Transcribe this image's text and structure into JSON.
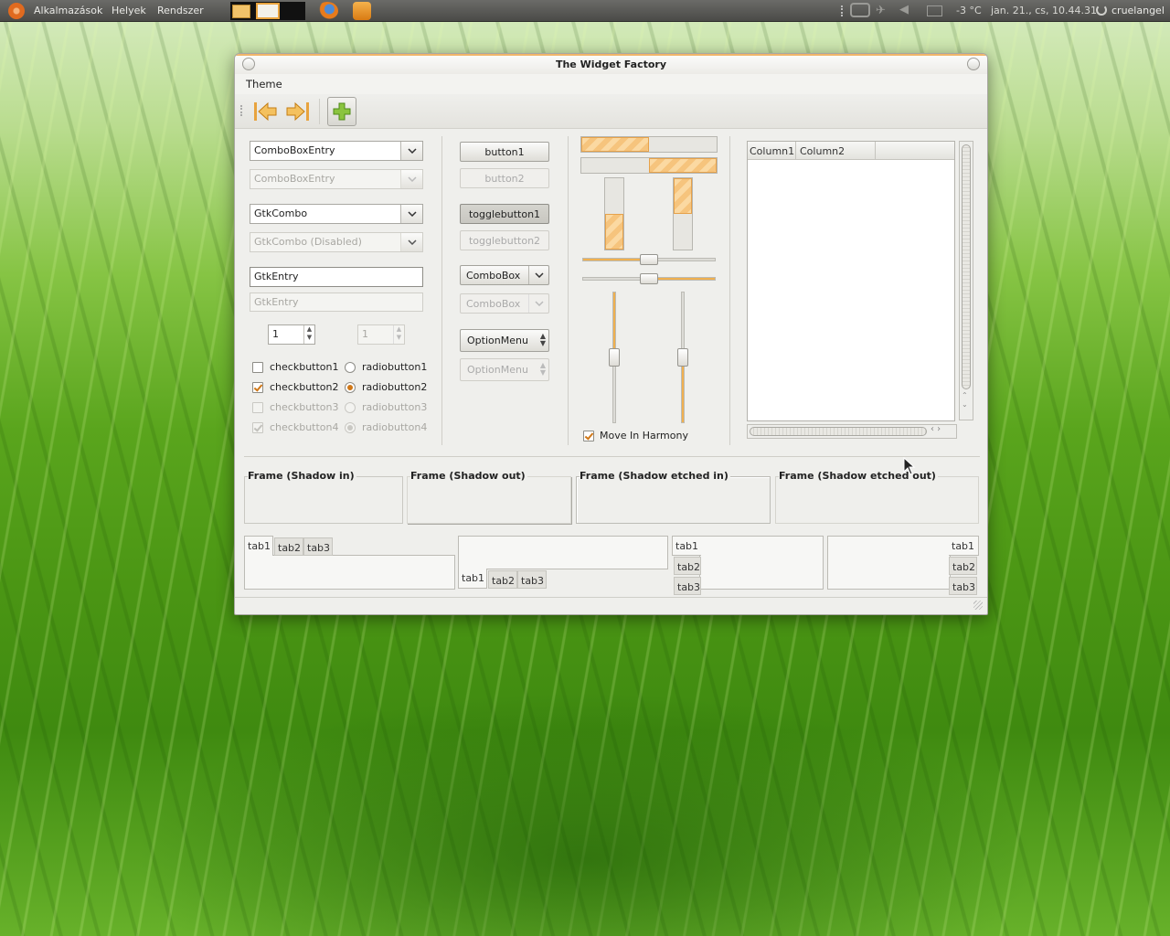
{
  "panel": {
    "menus": [
      "Alkalmazások",
      "Helyek",
      "Rendszer"
    ],
    "weather": "-3 °C",
    "clock": "jan. 21., cs, 10.44.31",
    "user": "cruelangel"
  },
  "window": {
    "title": "The Widget Factory",
    "menu_theme": "Theme"
  },
  "col1": {
    "combo_entry": "ComboBoxEntry",
    "combo_entry_dis": "ComboBoxEntry",
    "gtk_combo": "GtkCombo",
    "gtk_combo_dis": "GtkCombo (Disabled)",
    "entry": "GtkEntry",
    "entry_dis": "GtkEntry",
    "spin": "1",
    "spin_dis": "1",
    "checks": [
      "checkbutton1",
      "checkbutton2",
      "checkbutton3",
      "checkbutton4"
    ],
    "radios": [
      "radiobutton1",
      "radiobutton2",
      "radiobutton3",
      "radiobutton4"
    ]
  },
  "col2": {
    "button1": "button1",
    "button2": "button2",
    "toggle1": "togglebutton1",
    "toggle2": "togglebutton2",
    "combobox": "ComboBox",
    "combobox_dis": "ComboBox",
    "option": "OptionMenu",
    "option_dis": "OptionMenu"
  },
  "col3": {
    "harmony": "Move In Harmony",
    "progress_h1": 0.5,
    "progress_h2": 0.5,
    "progress_v1": 0.5,
    "progress_v2": 0.5,
    "scale_h1": 0.5,
    "scale_h2": 0.5,
    "scale_v1": 0.5,
    "scale_v2": 0.5
  },
  "tree": {
    "columns": [
      "Column1",
      "Column2"
    ]
  },
  "frames": [
    "Frame (Shadow in)",
    "Frame (Shadow out)",
    "Frame (Shadow etched in)",
    "Frame (Shadow etched out)"
  ],
  "tabs": [
    "tab1",
    "tab2",
    "tab3"
  ],
  "colors": {
    "accent": "#f6c47d",
    "accent_border": "#e6a24b",
    "check": "#d07818"
  }
}
